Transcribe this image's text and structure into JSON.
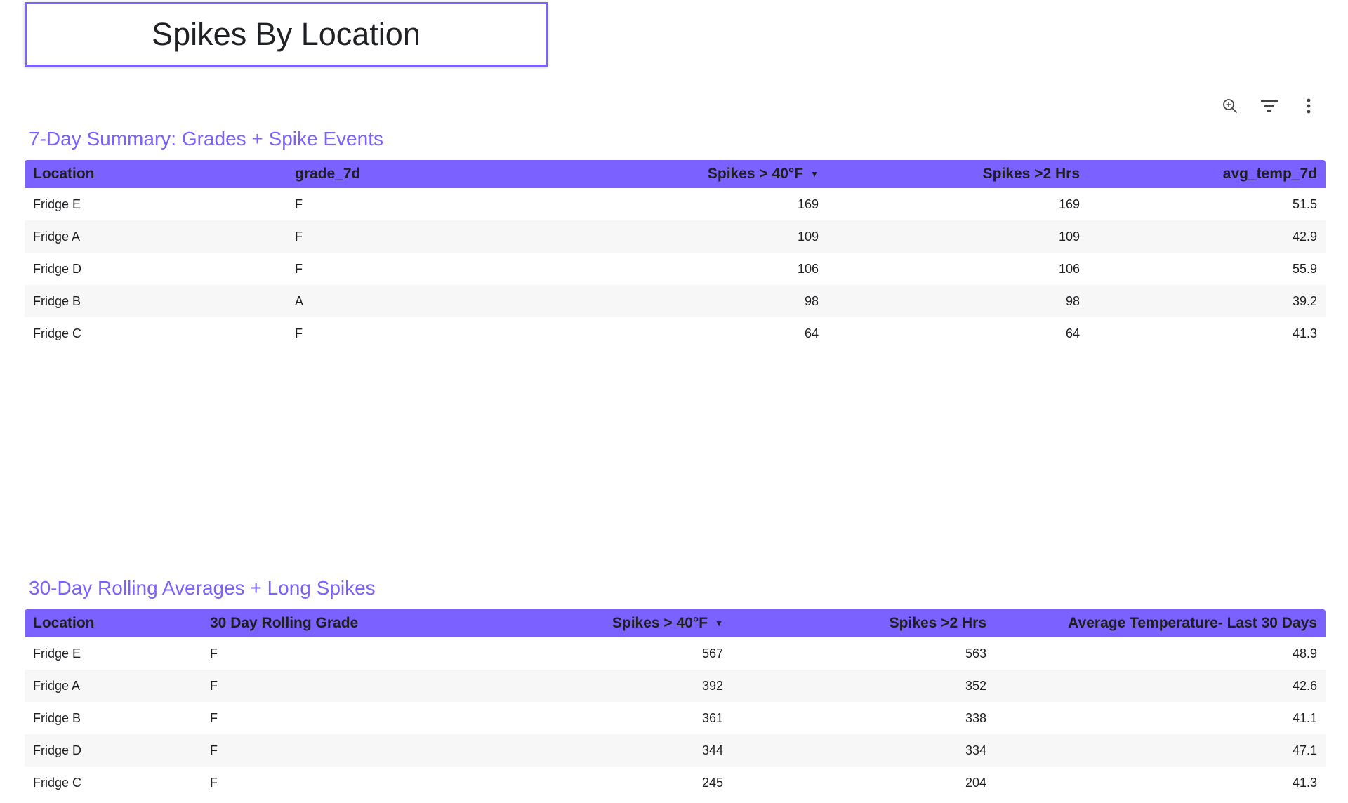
{
  "page_title": "Spikes By Location",
  "toolbar": {
    "icons": [
      "zoom-icon",
      "filter-icon",
      "more-vert-icon"
    ]
  },
  "colors": {
    "accent": "#7b61ff",
    "row_alt": "#f7f7f7"
  },
  "table1": {
    "title": "7-Day Summary: Grades + Spike Events",
    "columns": [
      "Location",
      "grade_7d",
      "Spikes > 40°F",
      "Spikes >2 Hrs",
      "avg_temp_7d"
    ],
    "sorted_column": "Spikes > 40°F",
    "sort_indicator": "▼",
    "rows": [
      [
        "Fridge E",
        "F",
        "169",
        "169",
        "51.5"
      ],
      [
        "Fridge A",
        "F",
        "109",
        "109",
        "42.9"
      ],
      [
        "Fridge D",
        "F",
        "106",
        "106",
        "55.9"
      ],
      [
        "Fridge B",
        "A",
        "98",
        "98",
        "39.2"
      ],
      [
        "Fridge C",
        "F",
        "64",
        "64",
        "41.3"
      ]
    ]
  },
  "table2": {
    "title": "30-Day Rolling Averages + Long Spikes",
    "columns": [
      "Location",
      "30 Day Rolling Grade",
      "Spikes > 40°F",
      "Spikes >2 Hrs",
      "Average Temperature- Last 30 Days"
    ],
    "sorted_column": "Spikes > 40°F",
    "sort_indicator": "▼",
    "rows": [
      [
        "Fridge E",
        "F",
        "567",
        "563",
        "48.9"
      ],
      [
        "Fridge A",
        "F",
        "392",
        "352",
        "42.6"
      ],
      [
        "Fridge B",
        "F",
        "361",
        "338",
        "41.1"
      ],
      [
        "Fridge D",
        "F",
        "344",
        "334",
        "47.1"
      ],
      [
        "Fridge C",
        "F",
        "245",
        "204",
        "41.3"
      ]
    ]
  }
}
